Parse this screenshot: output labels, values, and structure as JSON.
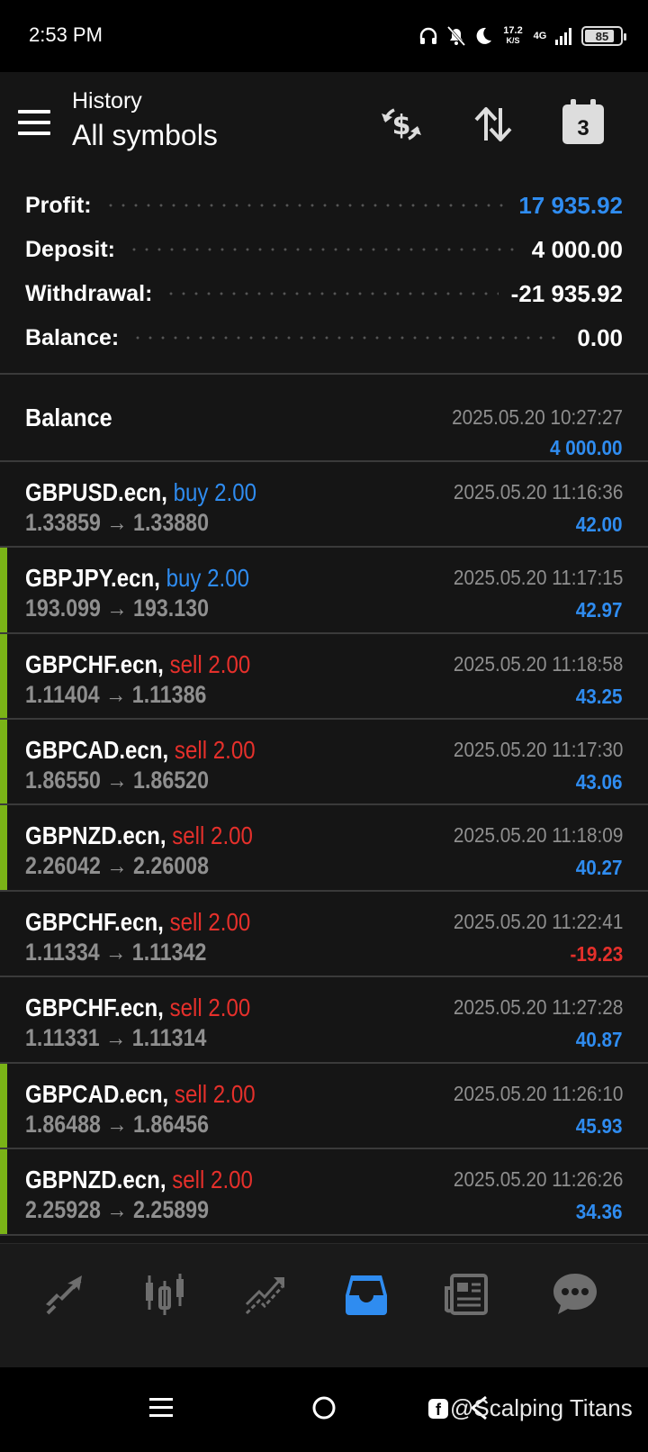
{
  "status_bar": {
    "time": "2:53 PM",
    "net_speed_value": "17.2",
    "net_speed_unit": "K/S",
    "network_type": "4G",
    "battery_level": "85"
  },
  "toolbar": {
    "title": "History",
    "subtitle": "All symbols",
    "calendar_day": "3"
  },
  "summary": {
    "profit_label": "Profit:",
    "profit_value": "17 935.92",
    "deposit_label": "Deposit:",
    "deposit_value": "4 000.00",
    "withdrawal_label": "Withdrawal:",
    "withdrawal_value": "-21 935.92",
    "balance_label": "Balance:",
    "balance_value": "0.00"
  },
  "balance_entry": {
    "label": "Balance",
    "time": "2025.05.20 10:27:27",
    "amount": "4 000.00"
  },
  "deals": [
    {
      "symbol": "GBPUSD.ecn,",
      "type": "buy 2.00",
      "prices": "1.33859 → 1.33880",
      "time": "2025.05.20 11:16:36",
      "profit": "42.00"
    },
    {
      "symbol": "GBPJPY.ecn,",
      "type": "buy 2.00",
      "prices": "193.099 → 193.130",
      "time": "2025.05.20 11:17:15",
      "profit": "42.97"
    },
    {
      "symbol": "GBPCHF.ecn,",
      "type": "sell 2.00",
      "prices": "1.11404 → 1.11386",
      "time": "2025.05.20 11:18:58",
      "profit": "43.25"
    },
    {
      "symbol": "GBPCAD.ecn,",
      "type": "sell 2.00",
      "prices": "1.86550 → 1.86520",
      "time": "2025.05.20 11:17:30",
      "profit": "43.06"
    },
    {
      "symbol": "GBPNZD.ecn,",
      "type": "sell 2.00",
      "prices": "2.26042 → 2.26008",
      "time": "2025.05.20 11:18:09",
      "profit": "40.27"
    },
    {
      "symbol": "GBPCHF.ecn,",
      "type": "sell 2.00",
      "prices": "1.11334 → 1.11342",
      "time": "2025.05.20 11:22:41",
      "profit": "-19.23"
    },
    {
      "symbol": "GBPCHF.ecn,",
      "type": "sell 2.00",
      "prices": "1.11331 → 1.11314",
      "time": "2025.05.20 11:27:28",
      "profit": "40.87"
    },
    {
      "symbol": "GBPCAD.ecn,",
      "type": "sell 2.00",
      "prices": "1.86488 → 1.86456",
      "time": "2025.05.20 11:26:10",
      "profit": "45.93"
    },
    {
      "symbol": "GBPNZD.ecn,",
      "type": "sell 2.00",
      "prices": "2.25928 → 2.25899",
      "time": "2025.05.20 11:26:26",
      "profit": "34.36"
    }
  ],
  "bottom_nav": {
    "items": [
      "quotes-icon",
      "chart-icon",
      "trade-icon",
      "history-icon",
      "news-icon",
      "chat-icon"
    ],
    "active": "history-icon",
    "active_color": "#2f8cf0",
    "inactive_color": "#6e6e6e"
  },
  "colors": {
    "buy": "#2f8cf0",
    "sell": "#e5302b",
    "profit_positive": "#2f8cf0",
    "profit_negative": "#e5302b",
    "row_accent": "#7ab317"
  },
  "watermark": {
    "logo": "f",
    "text": "@Scalping Titans"
  }
}
